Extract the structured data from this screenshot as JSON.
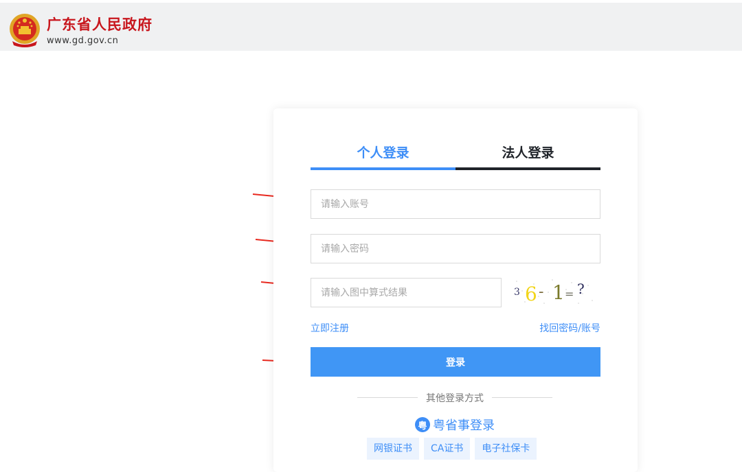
{
  "header": {
    "title": "广东省人民政府",
    "url": "www.gd.gov.cn"
  },
  "login": {
    "tabs": [
      {
        "label": "个人登录",
        "active": true
      },
      {
        "label": "法人登录",
        "active": false
      }
    ],
    "account_placeholder": "请输入账号",
    "password_placeholder": "请输入密码",
    "captcha_placeholder": "请输入图中算式结果",
    "captcha_text": "36-1=?",
    "register_link": "立即注册",
    "find_link": "找回密码/账号",
    "login_button": "登录",
    "other_methods": "其他登录方式",
    "yss_icon": "粤",
    "yss_label": "粤省事登录",
    "alt_methods": [
      "网银证书",
      "CA证书",
      "电子社保卡"
    ]
  },
  "colors": {
    "accent": "#3e8ef7",
    "brand_red": "#c8161d",
    "button": "#4096f5",
    "annotation_arrow": "#e8281e"
  }
}
